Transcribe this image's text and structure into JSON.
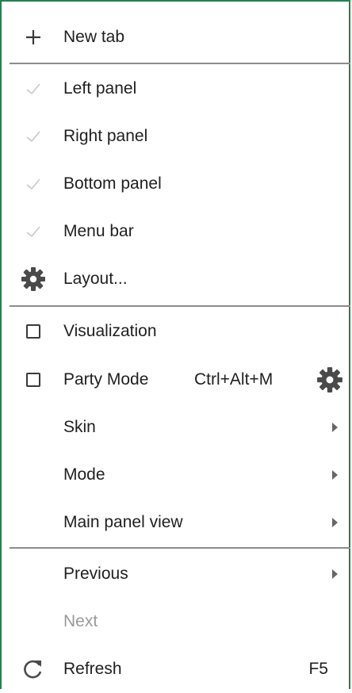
{
  "menu": {
    "new_tab": "New tab",
    "left_panel": "Left panel",
    "right_panel": "Right panel",
    "bottom_panel": "Bottom panel",
    "menu_bar": "Menu bar",
    "layout": "Layout...",
    "visualization": "Visualization",
    "party_mode": "Party Mode",
    "party_mode_shortcut": "Ctrl+Alt+M",
    "skin": "Skin",
    "mode": "Mode",
    "main_panel_view": "Main panel view",
    "previous": "Previous",
    "next": "Next",
    "refresh": "Refresh",
    "refresh_shortcut": "F5"
  },
  "icons": {
    "new_tab": "plus-icon",
    "check": "check-icon",
    "layout": "gear-icon",
    "checkbox": "checkbox-icon",
    "party_settings": "gear-icon",
    "submenu": "chevron-right-icon",
    "refresh": "refresh-icon"
  },
  "colors": {
    "border": "#2f7a52",
    "text": "#1f1f1f",
    "disabled": "#9a9a9a",
    "icon": "#4a4a4a",
    "check": "#c9c9c9"
  }
}
